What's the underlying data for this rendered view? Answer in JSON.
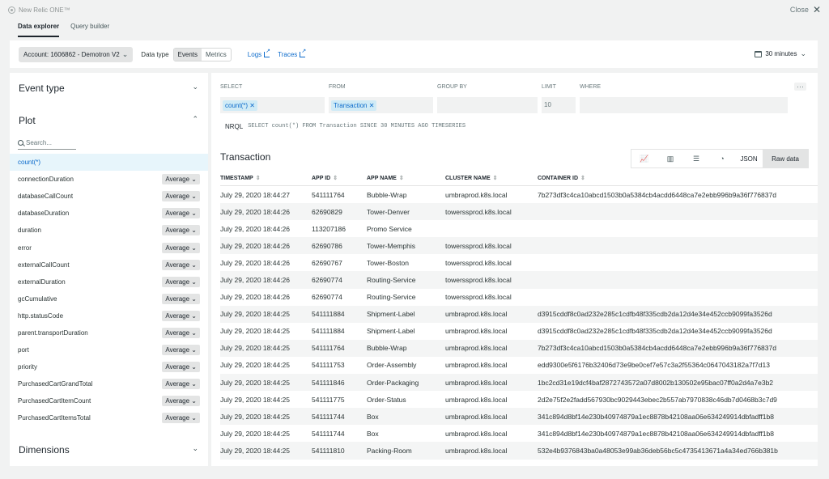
{
  "brand": "New Relic ONE™",
  "close_label": "Close",
  "tabs": [
    "Data explorer",
    "Query builder"
  ],
  "toolbar": {
    "account": "Account: 1606862 - Demotron V2",
    "data_type_label": "Data type",
    "data_types": [
      "Events",
      "Metrics"
    ],
    "logs_link": "Logs",
    "traces_link": "Traces",
    "time_range": "30 minutes"
  },
  "sidebar": {
    "event_type": "Event type",
    "plot": "Plot",
    "search_placeholder": "Search...",
    "dimensions": "Dimensions",
    "attributes": [
      {
        "name": "count(*)",
        "agg": ""
      },
      {
        "name": "connectionDuration",
        "agg": "Average"
      },
      {
        "name": "databaseCallCount",
        "agg": "Average"
      },
      {
        "name": "databaseDuration",
        "agg": "Average"
      },
      {
        "name": "duration",
        "agg": "Average"
      },
      {
        "name": "error",
        "agg": "Average"
      },
      {
        "name": "externalCallCount",
        "agg": "Average"
      },
      {
        "name": "externalDuration",
        "agg": "Average"
      },
      {
        "name": "gcCumulative",
        "agg": "Average"
      },
      {
        "name": "http.statusCode",
        "agg": "Average"
      },
      {
        "name": "parent.transportDuration",
        "agg": "Average"
      },
      {
        "name": "port",
        "agg": "Average"
      },
      {
        "name": "priority",
        "agg": "Average"
      },
      {
        "name": "PurchasedCartGrandTotal",
        "agg": "Average"
      },
      {
        "name": "PurchasedCartItemCount",
        "agg": "Average"
      },
      {
        "name": "PurchasedCartItemsTotal",
        "agg": "Average"
      }
    ]
  },
  "query": {
    "select_label": "SELECT",
    "from_label": "FROM",
    "groupby_label": "GROUP BY",
    "limit_label": "LIMIT",
    "where_label": "WHERE",
    "select_value": "count(*)",
    "from_value": "Transaction",
    "limit_value": "10",
    "nrql_label": "NRQL",
    "nrql": "SELECT count(*) FROM Transaction SINCE 30 MINUTES AGO TIMESERIES"
  },
  "results": {
    "title": "Transaction",
    "json_label": "JSON",
    "raw_label": "Raw data",
    "columns": [
      "TIMESTAMP",
      "APP ID",
      "APP NAME",
      "CLUSTER NAME",
      "CONTAINER ID"
    ],
    "rows": [
      [
        "July 29, 2020 18:44:27",
        "541111764",
        "Bubble-Wrap",
        "umbraprod.k8s.local",
        "7b273df3c4ca10abcd1503b0a5384cb4acdd6448ca7e2ebb996b9a36f776837d"
      ],
      [
        "July 29, 2020 18:44:26",
        "62690829",
        "Tower-Denver",
        "towerssprod.k8s.local",
        ""
      ],
      [
        "July 29, 2020 18:44:26",
        "113207186",
        "Promo Service",
        "",
        ""
      ],
      [
        "July 29, 2020 18:44:26",
        "62690786",
        "Tower-Memphis",
        "towerssprod.k8s.local",
        ""
      ],
      [
        "July 29, 2020 18:44:26",
        "62690767",
        "Tower-Boston",
        "towerssprod.k8s.local",
        ""
      ],
      [
        "July 29, 2020 18:44:26",
        "62690774",
        "Routing-Service",
        "towerssprod.k8s.local",
        ""
      ],
      [
        "July 29, 2020 18:44:26",
        "62690774",
        "Routing-Service",
        "towerssprod.k8s.local",
        ""
      ],
      [
        "July 29, 2020 18:44:25",
        "541111884",
        "Shipment-Label",
        "umbraprod.k8s.local",
        "d3915cddf8c0ad232e285c1cdfb48f335cdb2da12d4e34e452ccb9099fa3526d"
      ],
      [
        "July 29, 2020 18:44:25",
        "541111884",
        "Shipment-Label",
        "umbraprod.k8s.local",
        "d3915cddf8c0ad232e285c1cdfb48f335cdb2da12d4e34e452ccb9099fa3526d"
      ],
      [
        "July 29, 2020 18:44:25",
        "541111764",
        "Bubble-Wrap",
        "umbraprod.k8s.local",
        "7b273df3c4ca10abcd1503b0a5384cb4acdd6448ca7e2ebb996b9a36f776837d"
      ],
      [
        "July 29, 2020 18:44:25",
        "541111753",
        "Order-Assembly",
        "umbraprod.k8s.local",
        "edd9300e5f6176b32406d73e9be0cef7e57c3a2f55364c0647043182a7f7d13"
      ],
      [
        "July 29, 2020 18:44:25",
        "541111846",
        "Order-Packaging",
        "umbraprod.k8s.local",
        "1bc2cd31e19dcf4baf2872743572a07d8002b130502e95bac07ff0a2d4a7e3b2"
      ],
      [
        "July 29, 2020 18:44:25",
        "541111775",
        "Order-Status",
        "umbraprod.k8s.local",
        "2d2e75f2e2fadd567930bc9029443ebec2b557ab7970838c46db7d0468b3c7d9"
      ],
      [
        "July 29, 2020 18:44:25",
        "541111744",
        "Box",
        "umbraprod.k8s.local",
        "341c894d8bf14e230b40974879a1ec8878b42108aa06e634249914dbfadff1b8"
      ],
      [
        "July 29, 2020 18:44:25",
        "541111744",
        "Box",
        "umbraprod.k8s.local",
        "341c894d8bf14e230b40974879a1ec8878b42108aa06e634249914dbfadff1b8"
      ],
      [
        "July 29, 2020 18:44:25",
        "541111810",
        "Packing-Room",
        "umbraprod.k8s.local",
        "532e4b9376843ba0a48053e99ab36deb56bc5c4735413671a4a34ed766b381b"
      ]
    ]
  }
}
